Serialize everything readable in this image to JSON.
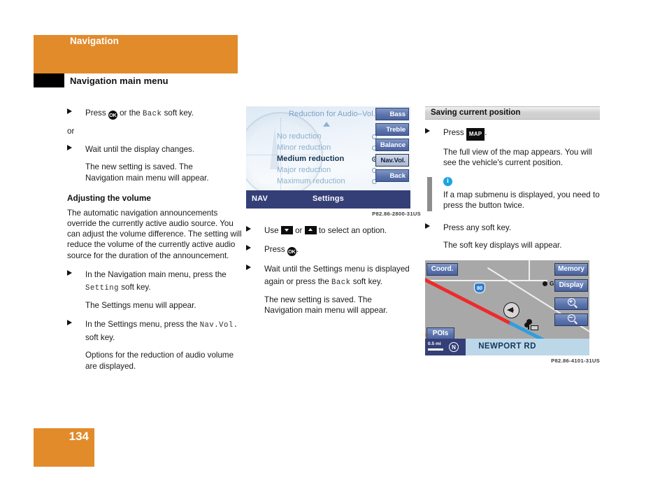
{
  "header": {
    "chapter": "Navigation",
    "section": "Navigation main menu"
  },
  "page_number": "134",
  "col1": {
    "step1": {
      "pre": "Press ",
      "key": "OK",
      "mid": " or the ",
      "mono": "Back",
      "post": " soft key."
    },
    "or": "or",
    "step2": "Wait until the display changes.",
    "result2_line1": "The new setting is saved. The",
    "result2_line2": "Navigation main menu will appear.",
    "subhead": "Adjusting the volume",
    "para1": "The automatic navigation announcements override the currently active audio source. You can adjust the volume difference. The setting will reduce the volume of the currently active audio source for the duration of the announcement.",
    "step3_pre": "In the Navigation main menu, press the ",
    "step3_mono": "Setting",
    "step3_post": " soft key.",
    "result3": "The Settings menu will appear.",
    "step4_pre": "In the Settings menu, press the ",
    "step4_mono": "Nav.Vol.",
    "step4_post": " soft key.",
    "result4": "Options for the reduction of audio volume are displayed."
  },
  "col2": {
    "figure_caption": "P82.86-2800-31US",
    "nav_screen": {
      "title": "Reduction for Audio–Vol.",
      "options": [
        {
          "label": "No reduction",
          "selected": false
        },
        {
          "label": "Minor reduction",
          "selected": false
        },
        {
          "label": "Medium reduction",
          "selected": true
        },
        {
          "label": "Major reduction",
          "selected": false
        },
        {
          "label": "Maximum reduction",
          "selected": false
        }
      ],
      "soft_keys": [
        {
          "label": "Bass",
          "highlighted": false
        },
        {
          "label": "Treble",
          "highlighted": false
        },
        {
          "label": "Balance",
          "highlighted": false
        },
        {
          "label": "Nav.Vol.",
          "highlighted": true
        },
        {
          "label": "Back",
          "highlighted": false
        }
      ],
      "status_left": "NAV",
      "status_center": "Settings"
    },
    "step1_pre": "Use ",
    "step1_mid": " or ",
    "step1_post": " to select an option.",
    "step2_pre": "Press ",
    "step2_key": "OK",
    "step2_post": ".",
    "step3_a": "Wait until the Settings menu is displayed again or press the ",
    "step3_mono": "Back",
    "step3_b": " soft key.",
    "result3_line1": "The new setting is saved. The",
    "result3_line2": "Navigation main menu will appear."
  },
  "col3": {
    "section_header": "Saving current position",
    "step1_pre": "Press ",
    "step1_key": "MAP",
    "step1_post": ".",
    "result1": "The full view of the map appears. You will see the vehicle's current position.",
    "note": "If a map submenu is displayed, you need to press the button twice.",
    "step2": "Press any soft key.",
    "result2": "The soft key displays will appear.",
    "figure_caption": "P82.86-4101-31US",
    "map_screen": {
      "soft_keys": {
        "coord": "Coord.",
        "pois": "POIs",
        "memory": "Memory",
        "display": "Display",
        "zoom_in": "zoom-in-icon",
        "zoom_out": "zoom-out-icon"
      },
      "city_label": "GENDA",
      "shield_label": "80",
      "street_name": "NEWPORT RD",
      "scale": "0.5 mi",
      "north_indicator": "N"
    }
  },
  "colors": {
    "orange": "#e28b2b",
    "nav_bar_blue": "#353f77",
    "soft_key_blue": "#5d75ad",
    "map_gray": "#a8a8a8",
    "street_bar": "#bcd8e8",
    "info_blue": "#1ba4e0",
    "road_red": "#ec2b2b",
    "road_blue": "#2f9fe0"
  }
}
